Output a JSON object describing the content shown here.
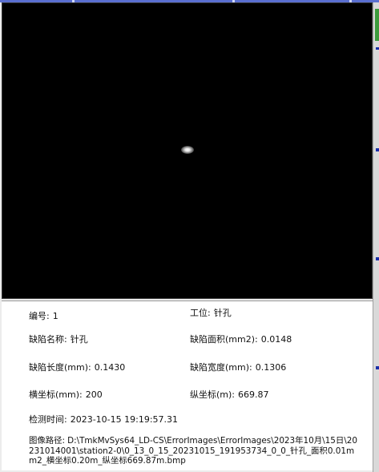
{
  "info": {
    "id_label": "编号:",
    "id_value": "1",
    "station_label": "工位:",
    "station_value": "针孔",
    "defect_name_label": "缺陷名称:",
    "defect_name_value": "针孔",
    "defect_area_label": "缺陷面积(mm2):",
    "defect_area_value": "0.0148",
    "defect_length_label": "缺陷长度(mm):",
    "defect_length_value": "0.1430",
    "defect_width_label": "缺陷宽度(mm):",
    "defect_width_value": "0.1306",
    "x_coord_label": "横坐标(mm):",
    "x_coord_value": "200",
    "y_coord_label": "纵坐标(m):",
    "y_coord_value": "669.87",
    "detect_time_label": "检测时间:",
    "detect_time_value": "2023-10-15 19:19:57.31",
    "image_path_label": "图像路径:",
    "image_path_value": "D:\\TmkMvSys64_LD-CS\\ErrorImages\\ErrorImages\\2023年10月\\15日\\20231014001\\station2-0\\0_13_0_15_20231015_191953734_0_0_针孔_面积0.01mm2_横坐标0.20m_纵坐标669.87m.bmp"
  },
  "colors": {
    "image_background": "#000000",
    "panel_background": "#ffffff",
    "rail_accent": "#1b2fa8"
  }
}
